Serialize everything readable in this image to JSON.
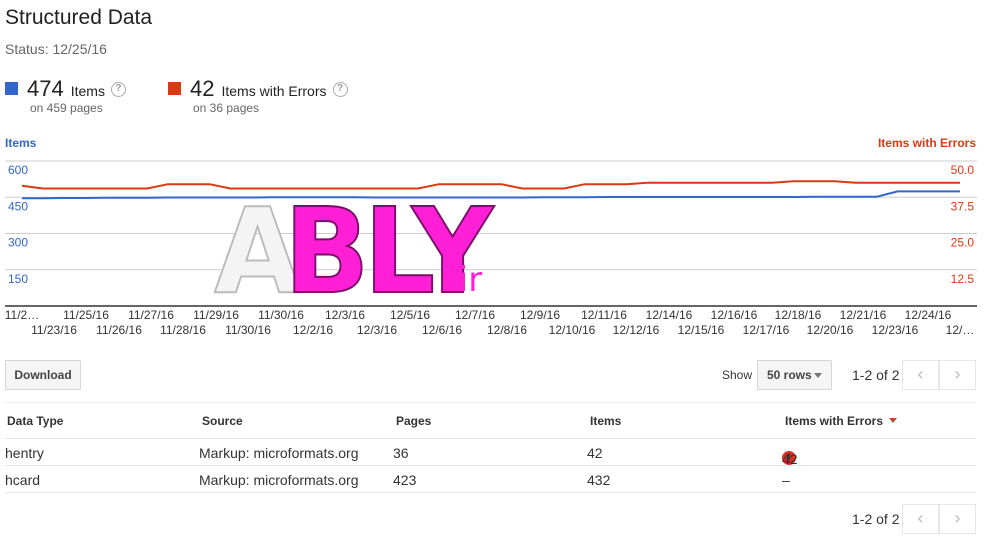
{
  "title": "Structured Data",
  "status": "Status: 12/25/16",
  "summary": {
    "items": {
      "count": "474",
      "label": "Items",
      "sub": "on 459 pages",
      "color": "#3366cc"
    },
    "errors": {
      "count": "42",
      "label": "Items with Errors",
      "sub": "on 36 pages",
      "color": "#dc3912"
    }
  },
  "chart_data": {
    "type": "line",
    "left_axis_title": "Items",
    "right_axis_title": "Items with Errors",
    "left_ticks": [
      "600",
      "450",
      "300",
      "150"
    ],
    "right_ticks": [
      "50.0",
      "37.5",
      "25.0",
      "12.5"
    ],
    "left_range": [
      0,
      600
    ],
    "right_range": [
      0,
      50
    ],
    "x_labels_top": [
      "11/2…",
      "11/25/16",
      "11/27/16",
      "11/29/16",
      "11/30/16",
      "12/3/16",
      "12/5/16",
      "12/7/16",
      "12/9/16",
      "12/11/16",
      "12/14/16",
      "12/16/16",
      "12/18/16",
      "12/21/16",
      "12/24/16"
    ],
    "x_labels_bottom": [
      "11/23/16",
      "11/26/16",
      "11/28/16",
      "11/30/16",
      "12/2/16",
      "12/3/16",
      "12/6/16",
      "12/8/16",
      "12/10/16",
      "12/12/16",
      "12/15/16",
      "12/17/16",
      "12/20/16",
      "12/23/16",
      "12/…"
    ],
    "series": [
      {
        "name": "Items",
        "color": "#3366cc",
        "axis": "left",
        "values": [
          446,
          446,
          447,
          447,
          448,
          448,
          448,
          449,
          449,
          449,
          449,
          449,
          450,
          450,
          450,
          450,
          450,
          449,
          449,
          449,
          449,
          449,
          449,
          449,
          449,
          450,
          450,
          450,
          451,
          451,
          451,
          451,
          451,
          451,
          451,
          451,
          451,
          451,
          452,
          452,
          452,
          452,
          474,
          474,
          474,
          474
        ]
      },
      {
        "name": "Items with Errors",
        "color": "#dc3912",
        "axis": "right",
        "values": [
          41.5,
          40.5,
          40.5,
          40.5,
          40.5,
          40.5,
          40.5,
          42,
          42,
          42,
          40.5,
          40.5,
          40.5,
          40.5,
          40.5,
          40.5,
          40.5,
          40.5,
          40.5,
          40.5,
          42,
          42,
          42,
          42,
          40.5,
          40.5,
          40.5,
          42,
          42,
          42,
          42.5,
          42.5,
          42.5,
          42.5,
          42.5,
          42.5,
          42.5,
          43,
          43,
          43,
          42.5,
          42.5,
          42.5,
          42.5,
          42.5,
          42.5
        ]
      }
    ],
    "grid": true
  },
  "toolbar": {
    "download": "Download",
    "show": "Show",
    "rows": "50 rows",
    "pager": "1-2 of 2",
    "prev": "‹",
    "next": "›"
  },
  "table": {
    "headers": {
      "type": "Data Type",
      "source": "Source",
      "pages": "Pages",
      "items": "Items",
      "errors": "Items with Errors"
    },
    "rows": [
      {
        "type": "hentry",
        "source": "Markup: microformats.org",
        "pages": "36",
        "items": "42",
        "errors": "42",
        "error_icon": "!"
      },
      {
        "type": "hcard",
        "source": "Markup: microformats.org",
        "pages": "423",
        "items": "432",
        "errors": "–",
        "error_icon": ""
      }
    ]
  },
  "watermark": {
    "a": "A",
    "bly": "BLY",
    "ir": ".ir"
  }
}
